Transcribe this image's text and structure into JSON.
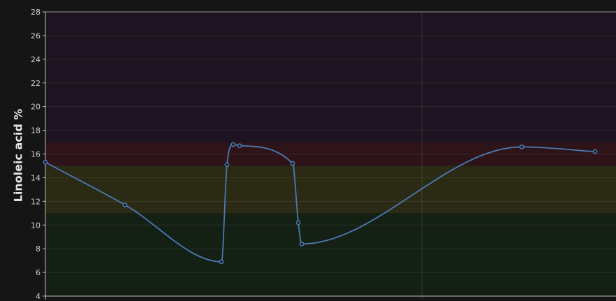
{
  "chart_data": {
    "type": "line",
    "title": "",
    "xlabel": "",
    "ylabel": "Linoleic acid %",
    "ylim": [
      4,
      28
    ],
    "yticks": [
      4,
      6,
      8,
      10,
      12,
      14,
      16,
      18,
      20,
      22,
      24,
      26,
      28
    ],
    "xlim": [
      0,
      1
    ],
    "x_gridlines": [
      0.5
    ],
    "grid": true,
    "legend": "none",
    "bands": [
      {
        "from": 4,
        "to": 11,
        "color": "#142014"
      },
      {
        "from": 11,
        "to": 15,
        "color": "#2b2a14"
      },
      {
        "from": 15,
        "to": 17,
        "color": "#2e1418"
      },
      {
        "from": 17,
        "to": 28,
        "color": "#1e1320"
      }
    ],
    "series": [
      {
        "color": "#4a7ab3",
        "points": [
          {
            "x": 0.0,
            "y": 15.3
          },
          {
            "x": 0.1058,
            "y": 11.7
          },
          {
            "x": 0.2338,
            "y": 6.9
          },
          {
            "x": 0.2412,
            "y": 15.1
          },
          {
            "x": 0.2495,
            "y": 16.8
          },
          {
            "x": 0.2579,
            "y": 16.7
          },
          {
            "x": 0.3284,
            "y": 15.2
          },
          {
            "x": 0.3359,
            "y": 10.2
          },
          {
            "x": 0.3405,
            "y": 8.4
          },
          {
            "x": 0.6327,
            "y": 16.6
          },
          {
            "x": 0.7301,
            "y": 16.2
          }
        ]
      }
    ]
  }
}
